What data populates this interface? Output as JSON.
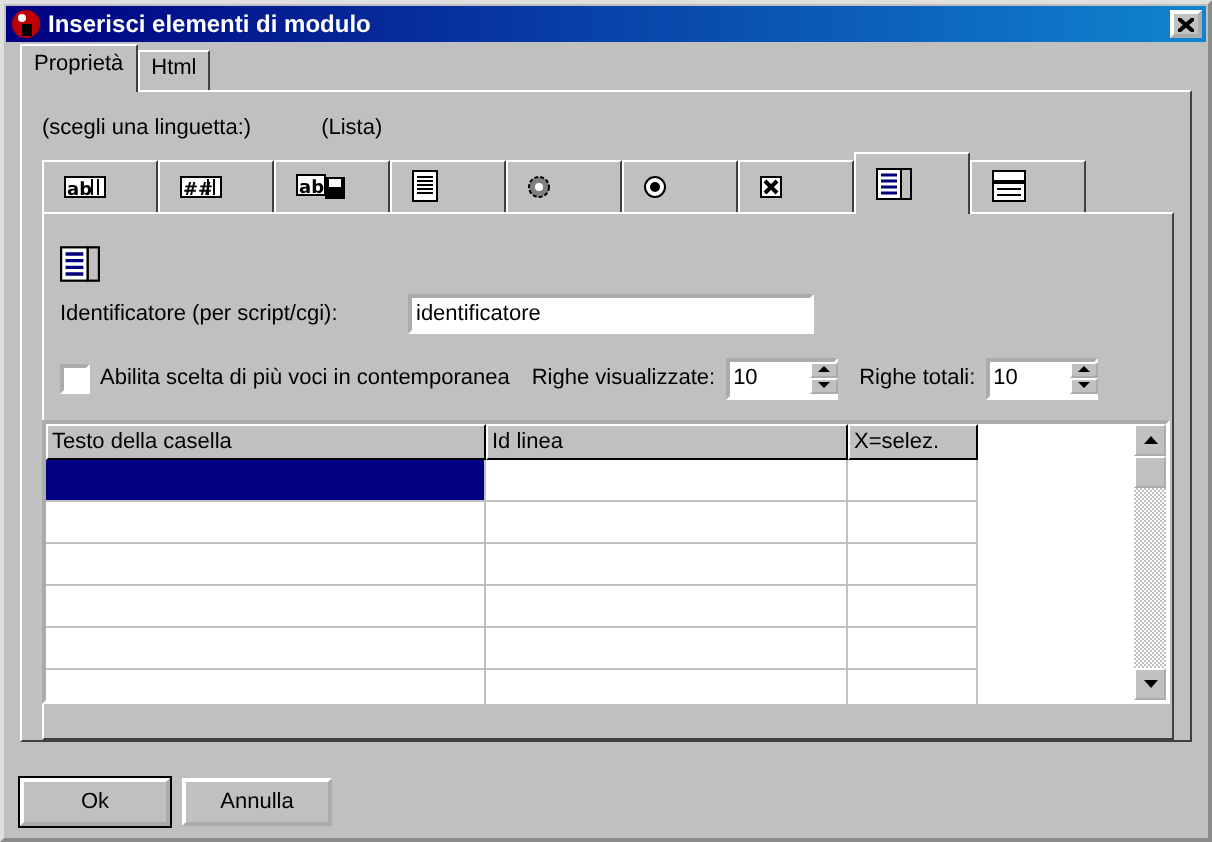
{
  "window": {
    "title": "Inserisci elementi di modulo"
  },
  "tabs": [
    {
      "label": "Proprietà",
      "selected": true
    },
    {
      "label": "Html",
      "selected": false
    }
  ],
  "hint": "(scegli una linguetta:)",
  "current_type": "(Lista)",
  "element_tabs": [
    {
      "kind": "text",
      "glyph": "ab",
      "selected": false
    },
    {
      "kind": "password",
      "glyph": "##",
      "selected": false
    },
    {
      "kind": "file",
      "glyph": "ab",
      "selected": false
    },
    {
      "kind": "textarea",
      "selected": false
    },
    {
      "kind": "hidden",
      "selected": false
    },
    {
      "kind": "radio",
      "selected": false
    },
    {
      "kind": "checkbox",
      "selected": false
    },
    {
      "kind": "list",
      "selected": true
    },
    {
      "kind": "combo",
      "selected": false
    }
  ],
  "identifier": {
    "label": "Identificatore (per script/cgi):",
    "value": "identificatore"
  },
  "multiple": {
    "label": "Abilita scelta di più voci in contemporanea",
    "checked": false
  },
  "visible_rows": {
    "label": "Righe visualizzate:",
    "value": "10"
  },
  "total_rows": {
    "label": "Righe totali:",
    "value": "10"
  },
  "table": {
    "columns": [
      "Testo della casella",
      "Id linea",
      "X=selez."
    ],
    "rows": [
      {
        "selected": true
      },
      {
        "selected": false
      },
      {
        "selected": false
      },
      {
        "selected": false
      },
      {
        "selected": false
      },
      {
        "selected": false
      }
    ]
  },
  "buttons": [
    "Ok",
    "Annulla"
  ]
}
